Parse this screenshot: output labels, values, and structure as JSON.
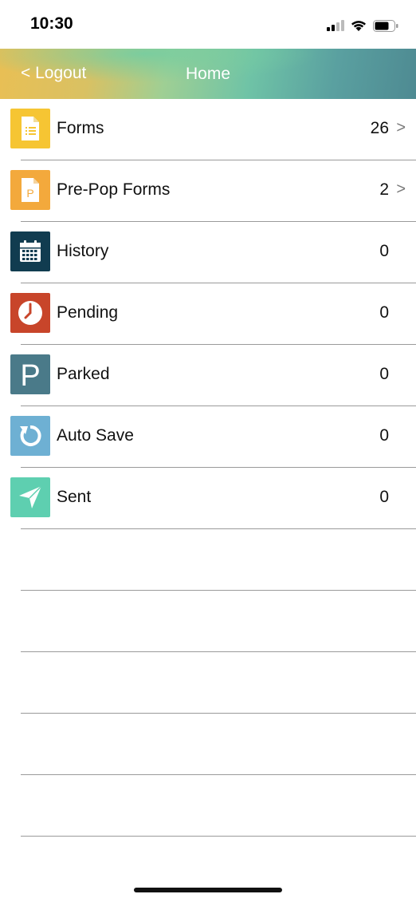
{
  "status": {
    "time": "10:30"
  },
  "nav": {
    "back_label": "< Logout",
    "title": "Home"
  },
  "rows": [
    {
      "label": "Forms",
      "count": "26",
      "chevron": ">",
      "icon": "forms-document-icon",
      "color": "#f6c533"
    },
    {
      "label": "Pre-Pop Forms",
      "count": "2",
      "chevron": ">",
      "icon": "prepop-document-icon",
      "color": "#f3a93c"
    },
    {
      "label": "History",
      "count": "0",
      "icon": "calendar-icon",
      "color": "#113c50"
    },
    {
      "label": "Pending",
      "count": "0",
      "icon": "clock-icon",
      "color": "#c8452a"
    },
    {
      "label": "Parked",
      "count": "0",
      "icon": "parking-icon",
      "color": "#4a7a89"
    },
    {
      "label": "Auto Save",
      "count": "0",
      "icon": "refresh-icon",
      "color": "#6eb0d3"
    },
    {
      "label": "Sent",
      "count": "0",
      "icon": "paper-plane-icon",
      "color": "#5ecfb0"
    }
  ]
}
